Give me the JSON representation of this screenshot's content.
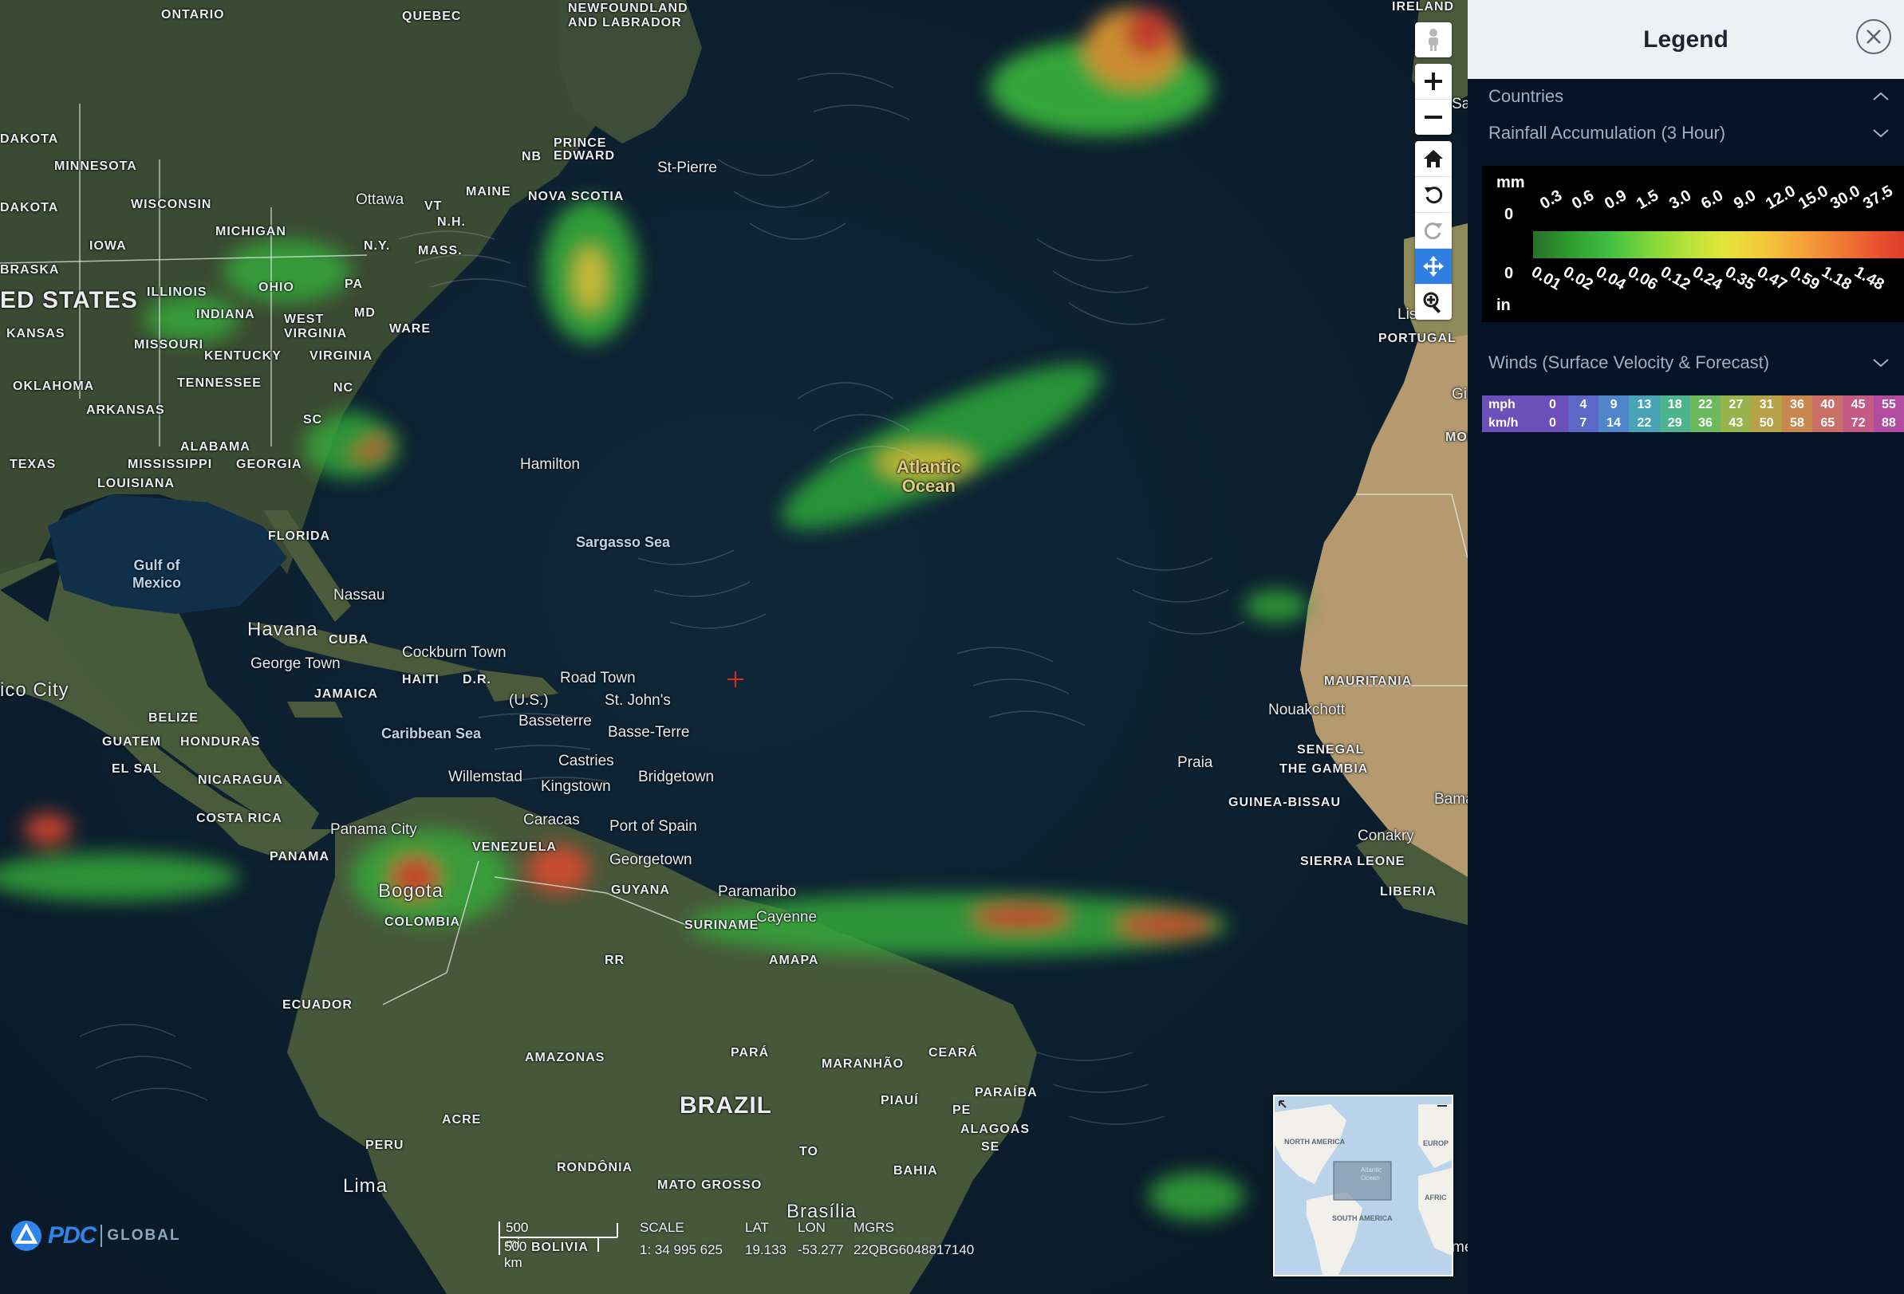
{
  "map": {
    "labels": {
      "ontario": "ONTARIO",
      "quebec": "QUEBEC",
      "newfoundland": "NEWFOUNDLAND\nAND LABRADOR",
      "ireland": "IRELAND",
      "dakota_n": "DAKOTA",
      "minnesota": "MINNESOTA",
      "dakota_s": "DAKOTA",
      "wisconsin": "WISCONSIN",
      "michigan": "MICHIGAN",
      "iowa": "IOWA",
      "nebraska": "BRASKA",
      "united_states": "ED STATES",
      "illinois": "ILLINOIS",
      "indiana": "INDIANA",
      "ohio": "OHIO",
      "kansas": "KANSAS",
      "missouri": "MISSOURI",
      "west_virginia": "WEST\nVIRGINIA",
      "kentucky": "KENTUCKY",
      "virginia": "VIRGINIA",
      "oklahoma": "OKLAHOMA",
      "tennessee": "TENNESSEE",
      "arkansas": "ARKANSAS",
      "nc": "NC",
      "sc": "SC",
      "alabama": "ALABAMA",
      "mississippi": "MISSISSIPPI",
      "georgia": "GEORGIA",
      "texas": "TEXAS",
      "louisiana": "LOUISIANA",
      "florida": "FLORIDA",
      "pa": "PA",
      "ny": "N.Y.",
      "maine": "MAINE",
      "vt": "VT",
      "nh": "N.H.",
      "mass": "MASS.",
      "md": "MD",
      "delaware": "WARE",
      "nb": "NB",
      "pei": "PRINCE\nEDWARD",
      "nova_scotia": "NOVA SCOTIA",
      "ottawa": "Ottawa",
      "st_pierre": "St-Pierre",
      "gulf_mexico": "Gulf of\nMexico",
      "hamilton": "Hamilton",
      "sargasso": "Sargasso Sea",
      "atlantic": "Atlantic\nOcean",
      "nassau": "Nassau",
      "havana": "Havana",
      "cuba": "CUBA",
      "george_town": "George Town",
      "cockburn": "Cockburn Town",
      "haiti": "HAITI",
      "dr": "D.R.",
      "jamaica": "JAMAICA",
      "road_town": "Road Town",
      "us": "(U.S.)",
      "st_johns": "St. John's",
      "basseterre": "Basseterre",
      "basse_terre": "Basse-Terre",
      "caribbean": "Caribbean Sea",
      "mexico_city": "ico City",
      "belize": "BELIZE",
      "guatemala": "GUATEM",
      "honduras": "HONDURAS",
      "el_salvador": "EL SAL",
      "nicaragua": "NICARAGUA",
      "costa_rica": "COSTA RICA",
      "panama": "PANAMA",
      "panama_city": "Panama City",
      "willemstad": "Willemstad",
      "castries": "Castries",
      "kingstown": "Kingstown",
      "bridgetown": "Bridgetown",
      "caracas": "Caracas",
      "port_of_spain": "Port of Spain",
      "venezuela": "VENEZUELA",
      "georgetown": "Georgetown",
      "guyana": "GUYANA",
      "paramaribo": "Paramaribo",
      "suriname": "SURINAME",
      "cayenne": "Cayenne",
      "amapa": "AMAPA",
      "rr": "RR",
      "bogota": "Bogota",
      "colombia": "COLOMBIA",
      "ecuador": "ECUADOR",
      "amazonas": "AMAZONAS",
      "para": "PARÁ",
      "maranhao": "MARANHÃO",
      "ceara": "CEARÁ",
      "piaui": "PIAUÍ",
      "paraiba": "PARAÍBA",
      "pe": "PE",
      "alagoas": "ALAGOAS",
      "se": "SE",
      "brazil": "BRAZIL",
      "acre": "ACRE",
      "peru": "PERU",
      "lima": "Lima",
      "rondonia": "RONDÔNIA",
      "to": "TO",
      "bahia": "BAHIA",
      "mato_grosso": "MATO GROSSO",
      "brasilia": "Brasília",
      "bolivia": "BOLIVIA",
      "portugal": "PORTUGAL",
      "lisbon": "Lis",
      "morocco": "MOR",
      "mauritania": "MAURITANIA",
      "nouakchott": "Nouakchott",
      "senegal": "SENEGAL",
      "gambia": "THE GAMBIA",
      "praia": "Praia",
      "guinea_bissau": "GUINEA-BISSAU",
      "bamako": "Bamako",
      "conakry": "Conakry",
      "sierra_leone": "SIERRA LEONE",
      "liberia": "LIBERIA",
      "sai": "Sai",
      "gi": "Gi",
      "me": "me"
    },
    "minimap": {
      "north_america": "NORTH AMERICA",
      "south_america": "SOUTH AMERICA",
      "europe": "EUROP",
      "africa": "AFRIC",
      "atlantic": "Atlantic\nOcean"
    },
    "scale": {
      "mi": "500 mi",
      "km": "500 km"
    },
    "coords": {
      "scale_label": "SCALE",
      "lat_label": "LAT",
      "lon_label": "LON",
      "mgrs_label": "MGRS",
      "scale_value": "1: 34 995 625",
      "lat_value": "19.133",
      "lon_value": "-53.277",
      "mgrs_value": "22QBG6048817140"
    },
    "logo": {
      "brand": "PDC",
      "sub": "GLOBAL"
    }
  },
  "toolbar": {
    "buttons": [
      {
        "name": "street-view",
        "icon": "pegman-icon"
      },
      {
        "name": "zoom-in",
        "icon": "plus-icon"
      },
      {
        "name": "zoom-out",
        "icon": "minus-icon"
      },
      {
        "name": "home",
        "icon": "home-icon"
      },
      {
        "name": "rotate-left",
        "icon": "rotate-left-icon"
      },
      {
        "name": "rotate-right",
        "icon": "rotate-right-icon"
      },
      {
        "name": "pan",
        "icon": "move-icon",
        "active": true
      },
      {
        "name": "zoom-box",
        "icon": "zoom-box-icon"
      }
    ],
    "active_color": "#2f7fe3"
  },
  "legend": {
    "title": "Legend",
    "countries": "Countries",
    "rainfall": {
      "title": "Rainfall Accumulation (3 Hour)",
      "unit_top": "mm",
      "unit_bottom": "in",
      "mm_ticks": [
        "0",
        "0.3",
        "0.6",
        "0.9",
        "1.5",
        "3.0",
        "6.0",
        "9.0",
        "12.0",
        "15.0",
        "30.0",
        "37.5"
      ],
      "in_ticks": [
        "0",
        "0.01",
        "0.02",
        "0.04",
        "0.06",
        "0.12",
        "0.24",
        "0.35",
        "0.47",
        "0.59",
        "1.18",
        "1.48"
      ],
      "colors": [
        "#2a6f2a",
        "#2e9e2e",
        "#43c043",
        "#7cd63a",
        "#b5e23a",
        "#e3e53a",
        "#f4c83a",
        "#f5a33a",
        "#f07a33",
        "#e8532e",
        "#d83128"
      ]
    },
    "winds": {
      "title": "Winds (Surface Velocity & Forecast)",
      "mph_label": "mph",
      "kmh_label": "km/h",
      "mph": [
        "0",
        "4",
        "9",
        "13",
        "18",
        "22",
        "27",
        "31",
        "36",
        "40",
        "45",
        "55"
      ],
      "kmh": [
        "0",
        "7",
        "14",
        "22",
        "29",
        "36",
        "43",
        "50",
        "58",
        "65",
        "72",
        "88"
      ],
      "colors": [
        "#6c4fb8",
        "#5b68c8",
        "#4f86c9",
        "#47a3b5",
        "#4cb38c",
        "#6bb85f",
        "#96b34c",
        "#b7a24a",
        "#c8874f",
        "#c96f66",
        "#c45b84",
        "#b14da0"
      ]
    }
  }
}
